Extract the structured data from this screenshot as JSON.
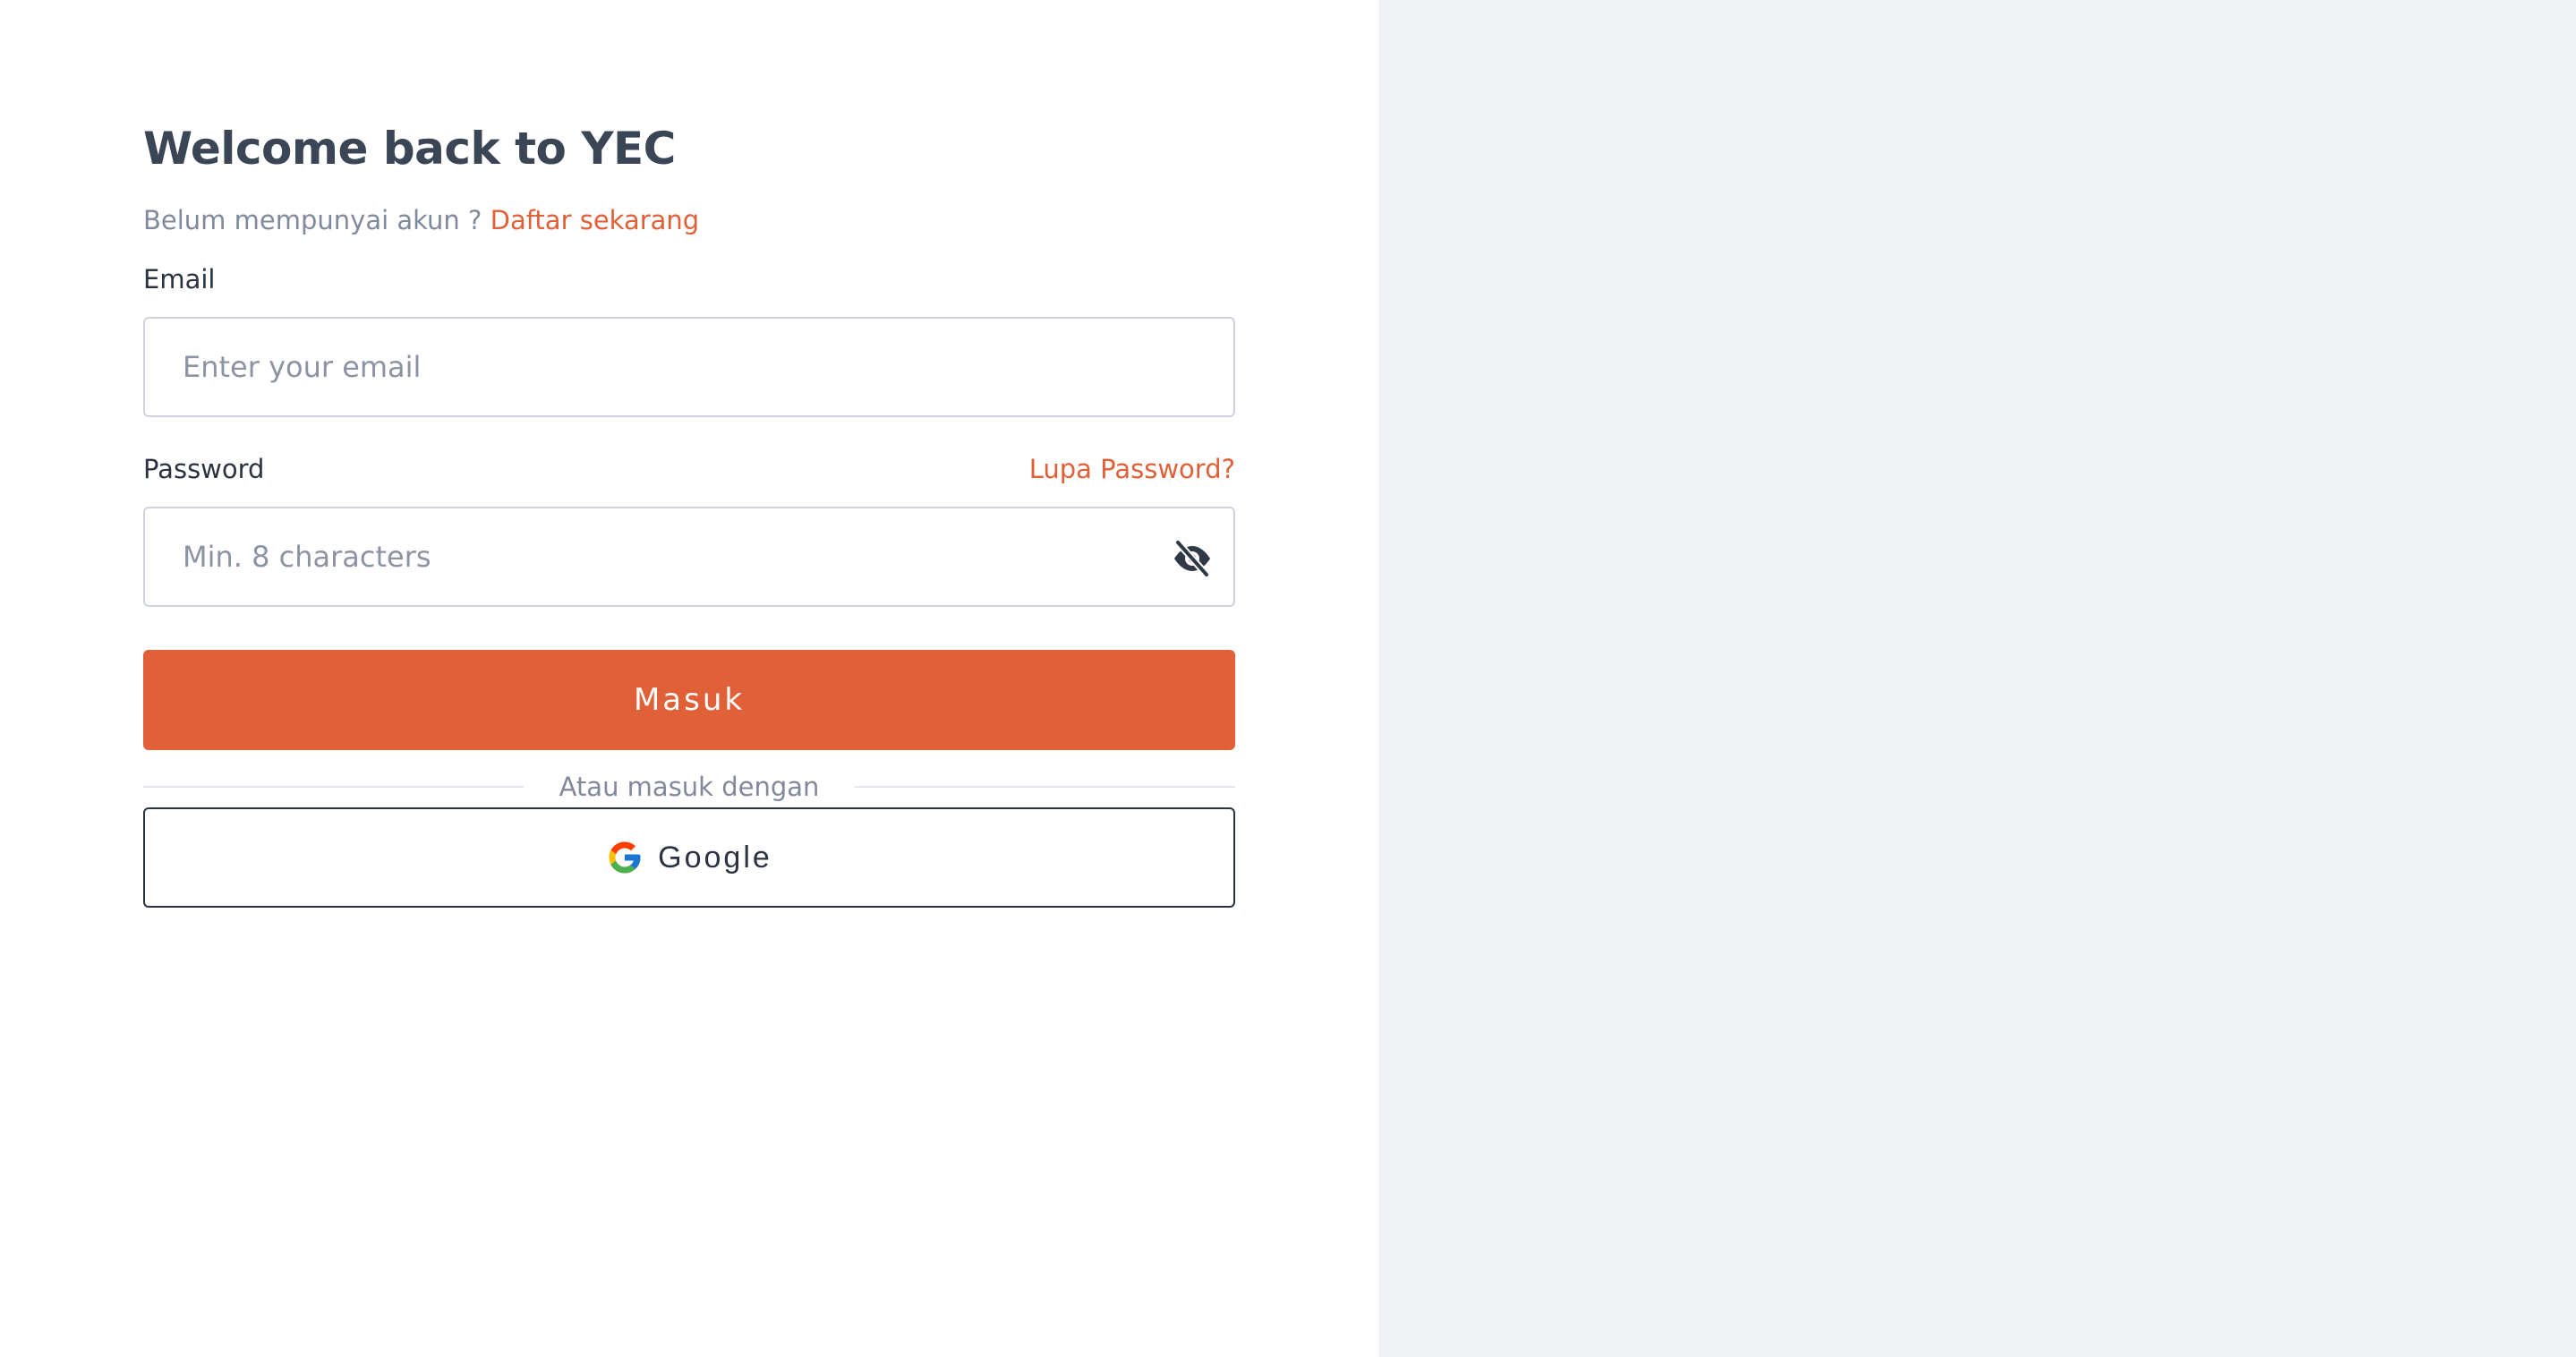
{
  "login": {
    "title": "Welcome back to YEC",
    "signup_prompt": "Belum mempunyai akun ?",
    "signup_link": "Daftar sekarang",
    "email": {
      "label": "Email",
      "placeholder": "Enter your email",
      "value": ""
    },
    "password": {
      "label": "Password",
      "forgot_link": "Lupa Password?",
      "placeholder": "Min. 8 characters",
      "value": "",
      "toggle_icon": "eye-off-icon"
    },
    "submit_label": "Masuk",
    "divider_text": "Atau masuk dengan",
    "google_label": "Google",
    "google_icon": "google-logo-icon"
  },
  "colors": {
    "accent": "#e06038",
    "heading": "#3a4555",
    "muted_text": "#808a9c",
    "input_border": "#cfd3e0",
    "right_panel_bg": "#f0f2f6",
    "google_border": "#2b3342"
  }
}
